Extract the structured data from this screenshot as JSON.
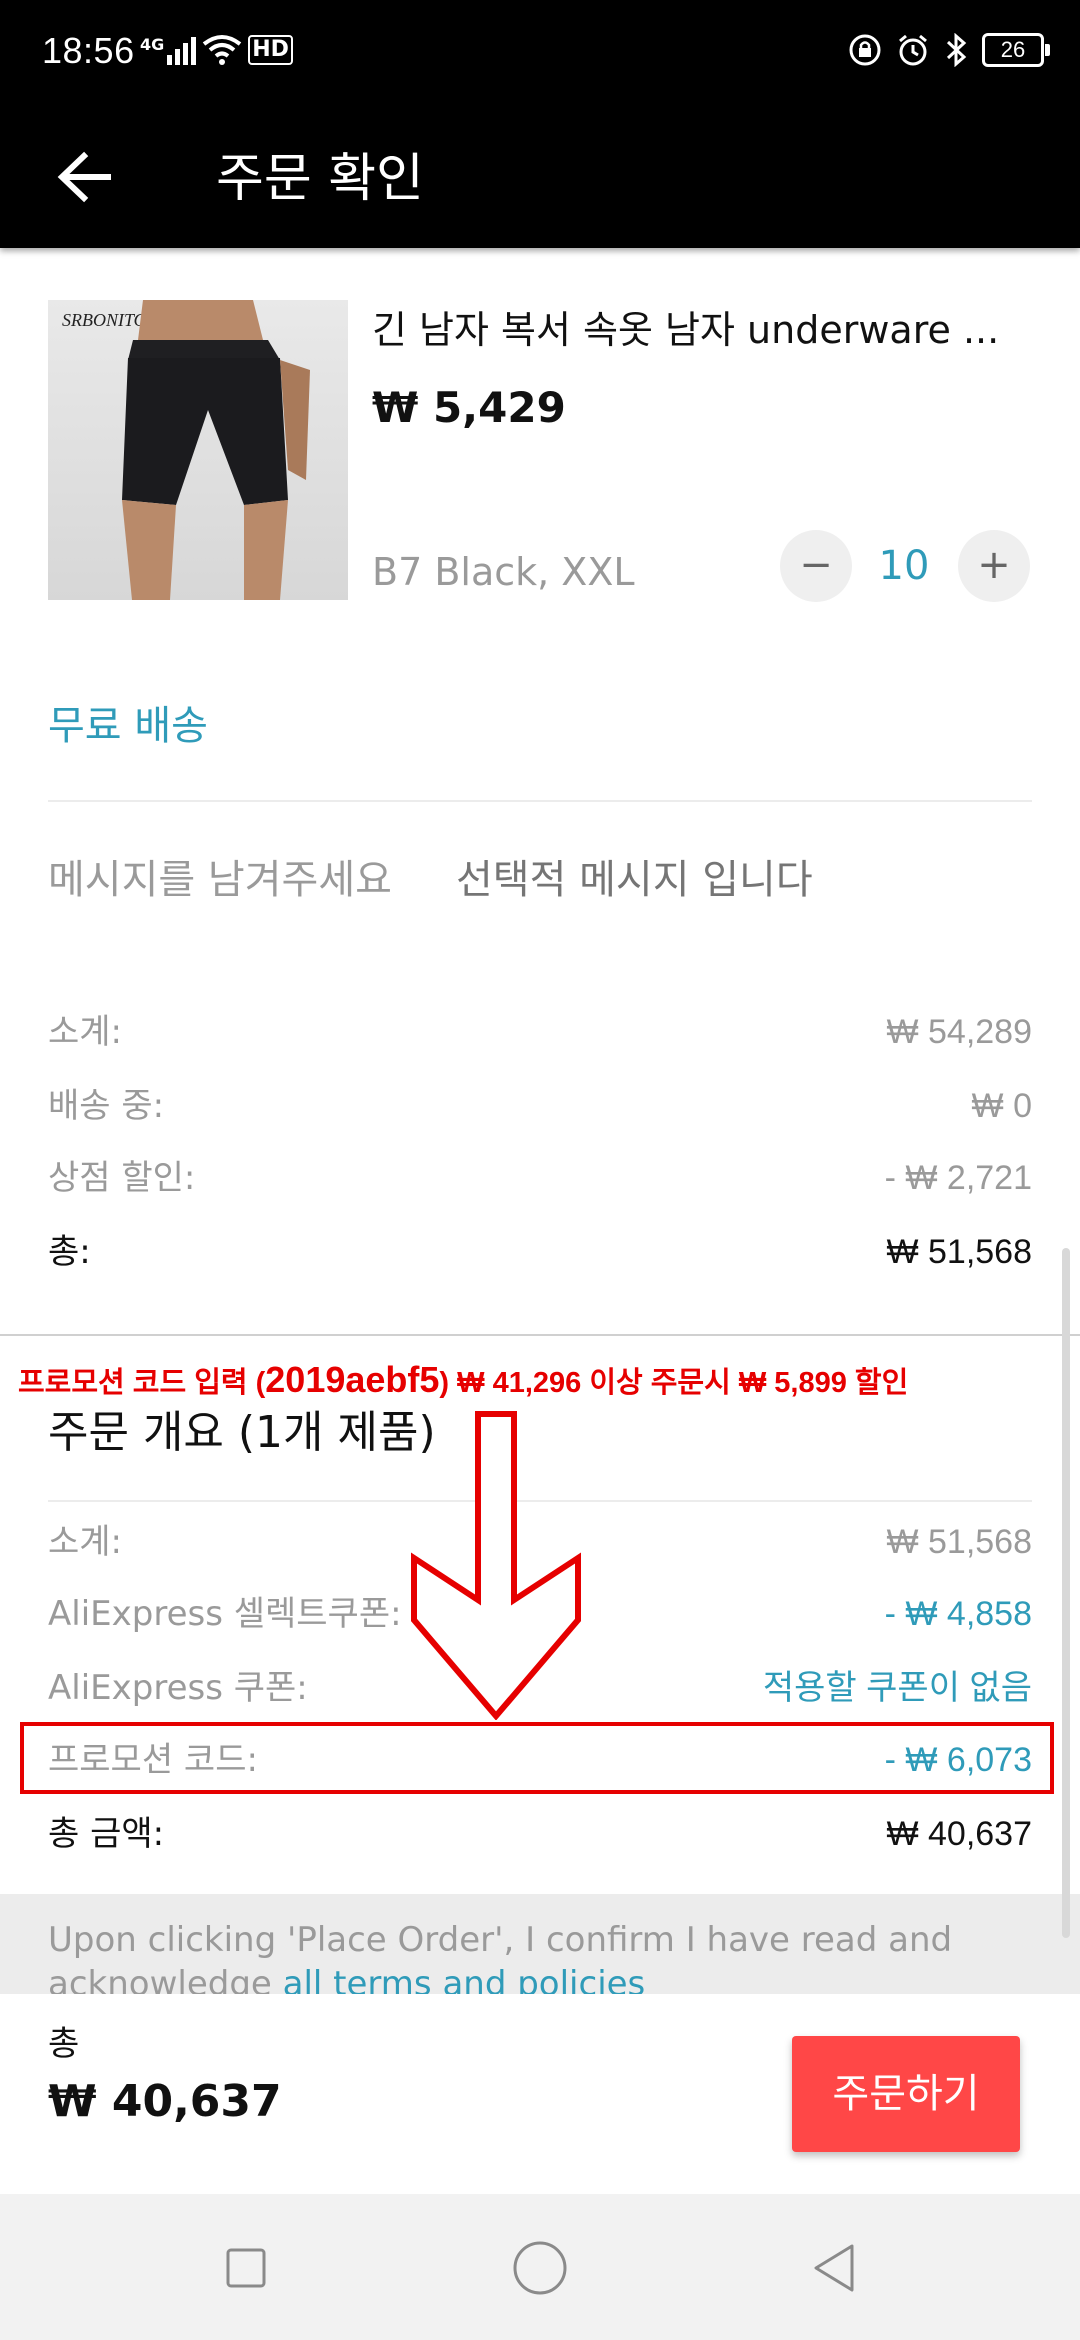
{
  "status_bar": {
    "time": "18:56",
    "network": "4G",
    "hd": "HD",
    "battery": "26"
  },
  "app_bar": {
    "title": "주문 확인"
  },
  "product": {
    "image_brand": "SRBONITOS",
    "title": "긴 남자 복서 속옷 남자 underware ...",
    "price": "₩ 5,429",
    "variant": "B7 Black, XXL",
    "quantity": "10",
    "minus": "−",
    "plus": "+"
  },
  "shipping": "무료 배송",
  "message": {
    "label": "메시지를 남겨주세요",
    "placeholder": "선택적 메시지 입니다"
  },
  "store_totals": {
    "subtotal_label": "소계:",
    "subtotal_value": "₩ 54,289",
    "shipping_label": "배송 중:",
    "shipping_value": "₩ 0",
    "discount_label": "상점 할인:",
    "discount_value": "- ₩ 2,721",
    "total_label": "총:",
    "total_value": "₩ 51,568"
  },
  "annotation": {
    "prefix": "프로모션 코드 입력 (",
    "code": "2019aebf5",
    "suffix": ") ₩ 41,296 이상 주문시 ₩ 5,899 할인"
  },
  "summary": {
    "title": "주문 개요 (1개 제품)",
    "subtotal_label": "소계:",
    "subtotal_value": "₩ 51,568",
    "select_coupon_label": "AliExpress 셀렉트쿠폰:",
    "select_coupon_value": "- ₩ 4,858",
    "coupon_label": "AliExpress 쿠폰:",
    "coupon_value": "적용할 쿠폰이 없음",
    "promo_label": "프로모션 코드:",
    "promo_value": "- ₩ 6,073",
    "grand_total_label": "총 금액:",
    "grand_total_value": "₩ 40,637"
  },
  "terms": {
    "text": "Upon clicking 'Place Order', I confirm I have read and acknowledge ",
    "link": "all terms and policies"
  },
  "bottom": {
    "total_label": "총",
    "total_amount": "₩ 40,637",
    "order_button": "주문하기"
  },
  "colors": {
    "accent_blue": "#2f9bb9",
    "order_red": "#ff4747",
    "annotation_red": "#e60000"
  }
}
